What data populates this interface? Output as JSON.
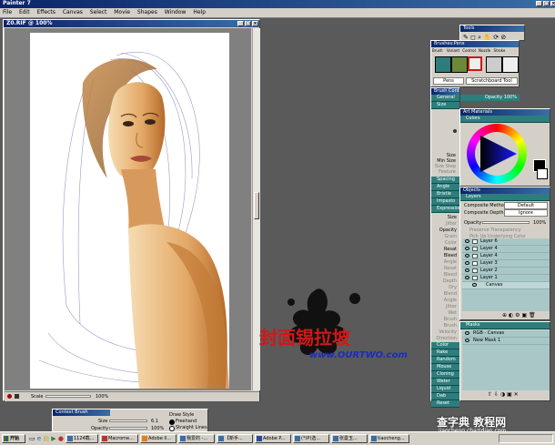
{
  "app": {
    "title": "Painter 7"
  },
  "menu": [
    "File",
    "Edit",
    "Effects",
    "Canvas",
    "Select",
    "Movie",
    "Shapes",
    "Window",
    "Help"
  ],
  "document": {
    "title": "Z0.RIF @ 100%",
    "zoom_label": "Scale",
    "zoom_value": "100%"
  },
  "tools": {
    "title": "Tools"
  },
  "brushes": {
    "title": "Brushes:Pens",
    "tabs": [
      "Brush",
      "Variant",
      "Control",
      "Nozzle",
      "Stroke"
    ],
    "selectors": [
      "Pens",
      "Scratchboard Tool"
    ]
  },
  "brush_controls": {
    "title": "Brush Controls",
    "general": "General",
    "opacity": "Opacity 100%",
    "size": "Size",
    "params": [
      "Size",
      "Min Size",
      "Size Step",
      "Feature"
    ],
    "sections": [
      "Spacing",
      "Angle",
      "Bristle",
      "Impasto",
      "Expression"
    ],
    "expression_params": [
      "Size",
      "Jitter",
      "Opacity",
      "Grain",
      "Color",
      "Resat",
      "Bleed",
      "Angle",
      "Resat",
      "Bleed",
      "Depth",
      "Dry",
      "Blend",
      "Angle",
      "Jitter",
      "Wet",
      "Brush",
      "Brush",
      "Velocity",
      "Direction"
    ],
    "more_sections": [
      "Color",
      "Rake",
      "Random",
      "Mouse",
      "Cloning",
      "Water",
      "Liquid",
      "Dab",
      "Reset"
    ]
  },
  "art_materials": {
    "title": "Art Materials",
    "colors": "Colors"
  },
  "objects": {
    "title": "Objects",
    "tab": "Layers",
    "composite_method_label": "Composite Method",
    "composite_method_value": "Default",
    "composite_depth_label": "Composite Depth",
    "composite_depth_value": "Ignore",
    "opacity_label": "Opacity",
    "opacity_value": "100%",
    "preserve": "Preserve Transparency",
    "pick_up": "Pick Up Underlying Color",
    "layers": [
      "Layer 6",
      "Layer 4",
      "Layer 4",
      "Layer 3",
      "Layer 2",
      "Layer 1"
    ],
    "canvas": "Canvas"
  },
  "masks": {
    "title": "Masks",
    "items": [
      "RGB - Canvas",
      "New Mask 1"
    ]
  },
  "context_brush": {
    "title": "Context Brush",
    "size_label": "Size",
    "size_value": "6.1",
    "opacity_label": "Opacity",
    "opacity_value": "100%",
    "draw_style_label": "Draw Style",
    "freehand": "Freehand",
    "straight": "Straight Lines"
  },
  "watermarks": {
    "site_cn": "封面锡拉坡",
    "site_url": "www.OURTWO.com",
    "logo_cn": "查字典 教程网",
    "logo_url": "jiaocheng.chazidian.com"
  },
  "taskbar": {
    "start": "开始",
    "tasks": [
      "1124截...",
      "Macrome...",
      "Adobe Il...",
      "我爱的 -...",
      "【新手...",
      "Adobe P...",
      "(*)P)选...",
      "张曼玉...",
      "tiaocheng..."
    ]
  },
  "colors": {
    "workspace": "#5a5a5a",
    "teal": "#2e7d7d",
    "title_blue": "#0a246a",
    "skin": "#e6b47a"
  }
}
